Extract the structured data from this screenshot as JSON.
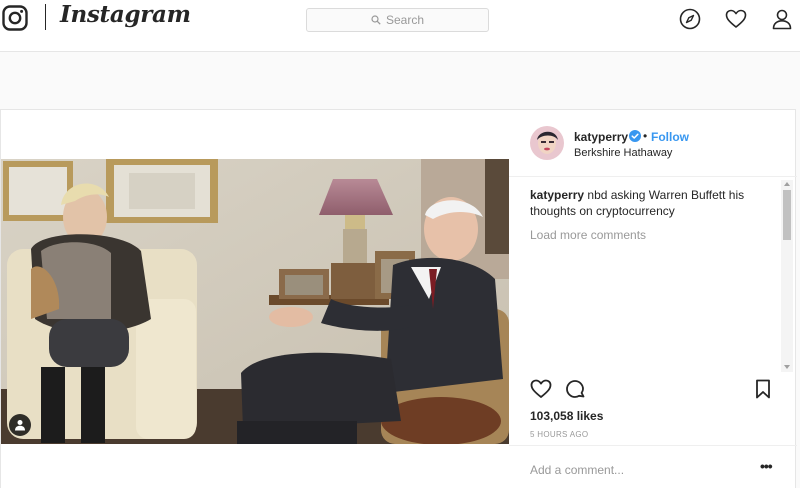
{
  "header": {
    "brand": "Instagram",
    "search_placeholder": "Search",
    "icons": [
      "instagram-glyph-icon",
      "compass-icon",
      "heart-icon",
      "person-icon"
    ]
  },
  "post": {
    "author": {
      "username": "katyperry",
      "verified": true,
      "follow_label": "Follow",
      "location": "Berkshire Hathaway"
    },
    "caption": {
      "username": "katyperry",
      "text": "nbd asking Warren Buffett his thoughts on cryptocurrency"
    },
    "load_more_label": "Load more comments",
    "likes_label": "103,058 likes",
    "timestamp": "5 HOURS AGO",
    "comment_placeholder": "Add a comment...",
    "more_label": "•••",
    "action_icons": [
      "heart-outline-icon",
      "comment-bubble-icon",
      "bookmark-icon"
    ],
    "photo_description_icon": "tagged-user-icon"
  },
  "colors": {
    "link_blue": "#3897f0",
    "verified_blue": "#3897f0",
    "text": "#262626",
    "muted": "#999999",
    "border": "#e6e6e6"
  }
}
